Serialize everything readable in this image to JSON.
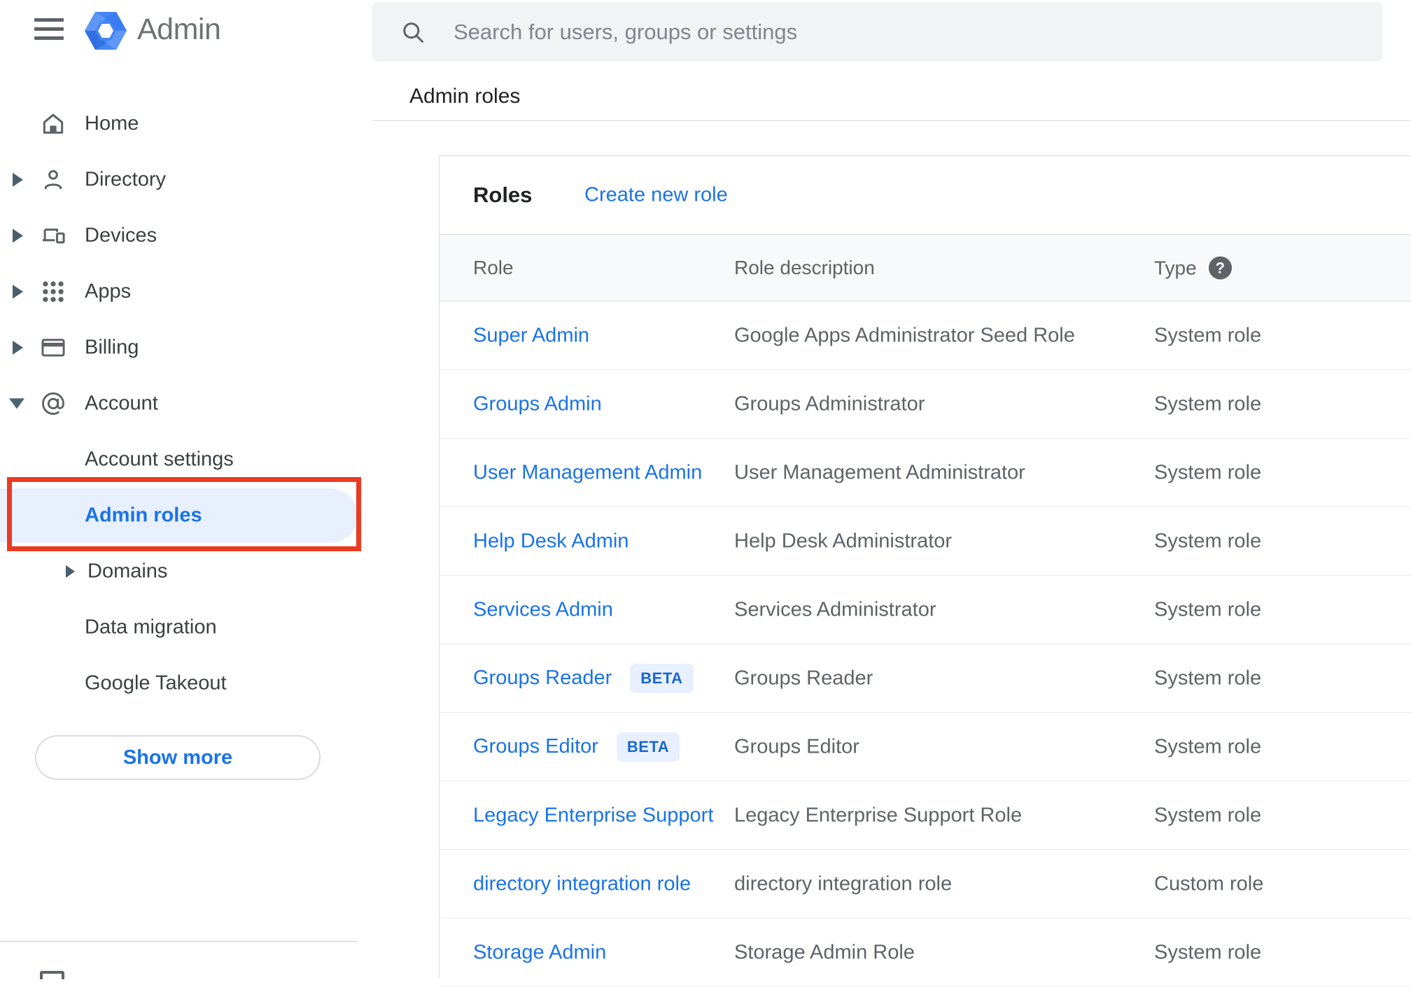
{
  "app": {
    "brand": "Admin"
  },
  "search": {
    "placeholder": "Search for users, groups or settings"
  },
  "breadcrumb": {
    "label": "Admin roles"
  },
  "sidebar": {
    "items": [
      {
        "label": "Home",
        "icon": "home",
        "caret": null,
        "indent": 0,
        "selected": false
      },
      {
        "label": "Directory",
        "icon": "person",
        "caret": "right",
        "indent": 0,
        "selected": false
      },
      {
        "label": "Devices",
        "icon": "devices",
        "caret": "right",
        "indent": 0,
        "selected": false
      },
      {
        "label": "Apps",
        "icon": "apps",
        "caret": "right",
        "indent": 0,
        "selected": false
      },
      {
        "label": "Billing",
        "icon": "card",
        "caret": "right",
        "indent": 0,
        "selected": false
      },
      {
        "label": "Account",
        "icon": "at",
        "caret": "down",
        "indent": 0,
        "selected": false
      },
      {
        "label": "Account settings",
        "icon": null,
        "caret": null,
        "indent": 1,
        "selected": false
      },
      {
        "label": "Admin roles",
        "icon": null,
        "caret": null,
        "indent": 1,
        "selected": true
      },
      {
        "label": "Domains",
        "icon": null,
        "caret": "sub",
        "indent": 1,
        "selected": false
      },
      {
        "label": "Data migration",
        "icon": null,
        "caret": null,
        "indent": 1,
        "selected": false
      },
      {
        "label": "Google Takeout",
        "icon": null,
        "caret": null,
        "indent": 1,
        "selected": false
      }
    ],
    "show_more_label": "Show more"
  },
  "main": {
    "title": "Roles",
    "create_link": "Create new role",
    "columns": [
      "Role",
      "Role description",
      "Type"
    ],
    "beta_label": "BETA",
    "rows": [
      {
        "role": "Super Admin",
        "beta": false,
        "description": "Google Apps Administrator Seed Role",
        "type": "System role"
      },
      {
        "role": "Groups Admin",
        "beta": false,
        "description": "Groups Administrator",
        "type": "System role"
      },
      {
        "role": "User Management Admin",
        "beta": false,
        "description": "User Management Administrator",
        "type": "System role"
      },
      {
        "role": "Help Desk Admin",
        "beta": false,
        "description": "Help Desk Administrator",
        "type": "System role"
      },
      {
        "role": "Services Admin",
        "beta": false,
        "description": "Services Administrator",
        "type": "System role"
      },
      {
        "role": "Groups Reader",
        "beta": true,
        "description": "Groups Reader",
        "type": "System role"
      },
      {
        "role": "Groups Editor",
        "beta": true,
        "description": "Groups Editor",
        "type": "System role"
      },
      {
        "role": "Legacy Enterprise Support",
        "beta": false,
        "description": "Legacy Enterprise Support Role",
        "type": "System role"
      },
      {
        "role": "directory integration role",
        "beta": false,
        "description": "directory integration role",
        "type": "Custom role"
      },
      {
        "role": "Storage Admin",
        "beta": false,
        "description": "Storage Admin Role",
        "type": "System role"
      }
    ]
  },
  "colors": {
    "accent_blue": "#1a73e8",
    "annotation_red": "#ea3b23",
    "selected_item_bg": "#e8f0fe",
    "beta_badge_bg": "#e8f0fe",
    "beta_badge_text": "#1967d2",
    "table_header_bg": "#f8f9fa",
    "searchbar_bg": "#f1f3f4",
    "icon_gray": "#5f6368"
  }
}
